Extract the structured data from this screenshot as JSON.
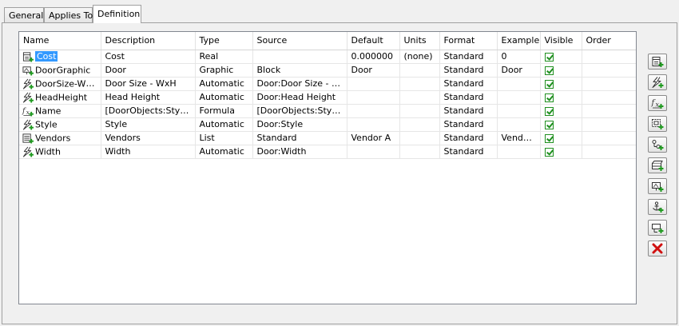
{
  "tabs": [
    {
      "label": "General",
      "active": false
    },
    {
      "label": "Applies To",
      "active": false
    },
    {
      "label": "Definition",
      "active": true
    }
  ],
  "columns": [
    "Name",
    "Description",
    "Type",
    "Source",
    "Default",
    "Units",
    "Format",
    "Example",
    "Visible",
    "Order"
  ],
  "rows": [
    {
      "icon": "manual-property-icon",
      "name": "Cost",
      "selected": true,
      "description": "Cost",
      "type": "Real",
      "source": "",
      "default": "0.000000",
      "units": "(none)",
      "format": "Standard",
      "example": "0",
      "visible": true,
      "order": ""
    },
    {
      "icon": "graphic-property-icon",
      "name": "DoorGraphic",
      "selected": false,
      "description": "Door",
      "type": "Graphic",
      "source": "Block",
      "default": "Door",
      "units": "",
      "format": "Standard",
      "example": "Door",
      "visible": true,
      "order": ""
    },
    {
      "icon": "automatic-property-icon",
      "name": "DoorSize-WxH",
      "selected": false,
      "description": "Door Size - WxH",
      "type": "Automatic",
      "source": "Door:Door Size - WxH",
      "default": "",
      "units": "",
      "format": "Standard",
      "example": "",
      "visible": true,
      "order": ""
    },
    {
      "icon": "automatic-property-icon",
      "name": "HeadHeight",
      "selected": false,
      "description": "Head Height",
      "type": "Automatic",
      "source": "Door:Head Height",
      "default": "",
      "units": "",
      "format": "Standard",
      "example": "",
      "visible": true,
      "order": ""
    },
    {
      "icon": "formula-property-icon",
      "name": "Name",
      "selected": false,
      "description": "[DoorObjects:Style]",
      "type": "Formula",
      "source": "[DoorObjects:Style]",
      "default": "",
      "units": "",
      "format": "Standard",
      "example": "",
      "visible": true,
      "order": ""
    },
    {
      "icon": "automatic-property-icon",
      "name": "Style",
      "selected": false,
      "description": "Style",
      "type": "Automatic",
      "source": "Door:Style",
      "default": "",
      "units": "",
      "format": "Standard",
      "example": "",
      "visible": true,
      "order": ""
    },
    {
      "icon": "list-property-icon",
      "name": "Vendors",
      "selected": false,
      "description": "Vendors",
      "type": "List",
      "source": "Standard",
      "default": "Vendor A",
      "units": "",
      "format": "Standard",
      "example": "Vend…",
      "visible": true,
      "order": ""
    },
    {
      "icon": "automatic-property-icon",
      "name": "Width",
      "selected": false,
      "description": "Width",
      "type": "Automatic",
      "source": "Door:Width",
      "default": "",
      "units": "",
      "format": "Standard",
      "example": "",
      "visible": true,
      "order": ""
    }
  ],
  "toolbar": [
    {
      "name": "add-manual-property-button",
      "icon": "manual-property-icon"
    },
    {
      "name": "add-automatic-property-button",
      "icon": "automatic-property-icon"
    },
    {
      "name": "add-formula-property-button",
      "icon": "formula-property-icon"
    },
    {
      "name": "add-location-property-button",
      "icon": "location-property-icon"
    },
    {
      "name": "add-classification-property-button",
      "icon": "classification-property-icon"
    },
    {
      "name": "add-material-property-button",
      "icon": "material-property-icon"
    },
    {
      "name": "add-graphic-property-button",
      "icon": "graphic-property-icon"
    },
    {
      "name": "add-anchor-property-button",
      "icon": "anchor-property-icon"
    },
    {
      "name": "add-property-set-property-button",
      "icon": "property-set-icon"
    },
    {
      "name": "remove-property-button",
      "icon": "delete-x-icon"
    }
  ],
  "colors": {
    "selection": "#3399ff",
    "accent_green": "#1f9a1f",
    "delete_red": "#d01010"
  }
}
